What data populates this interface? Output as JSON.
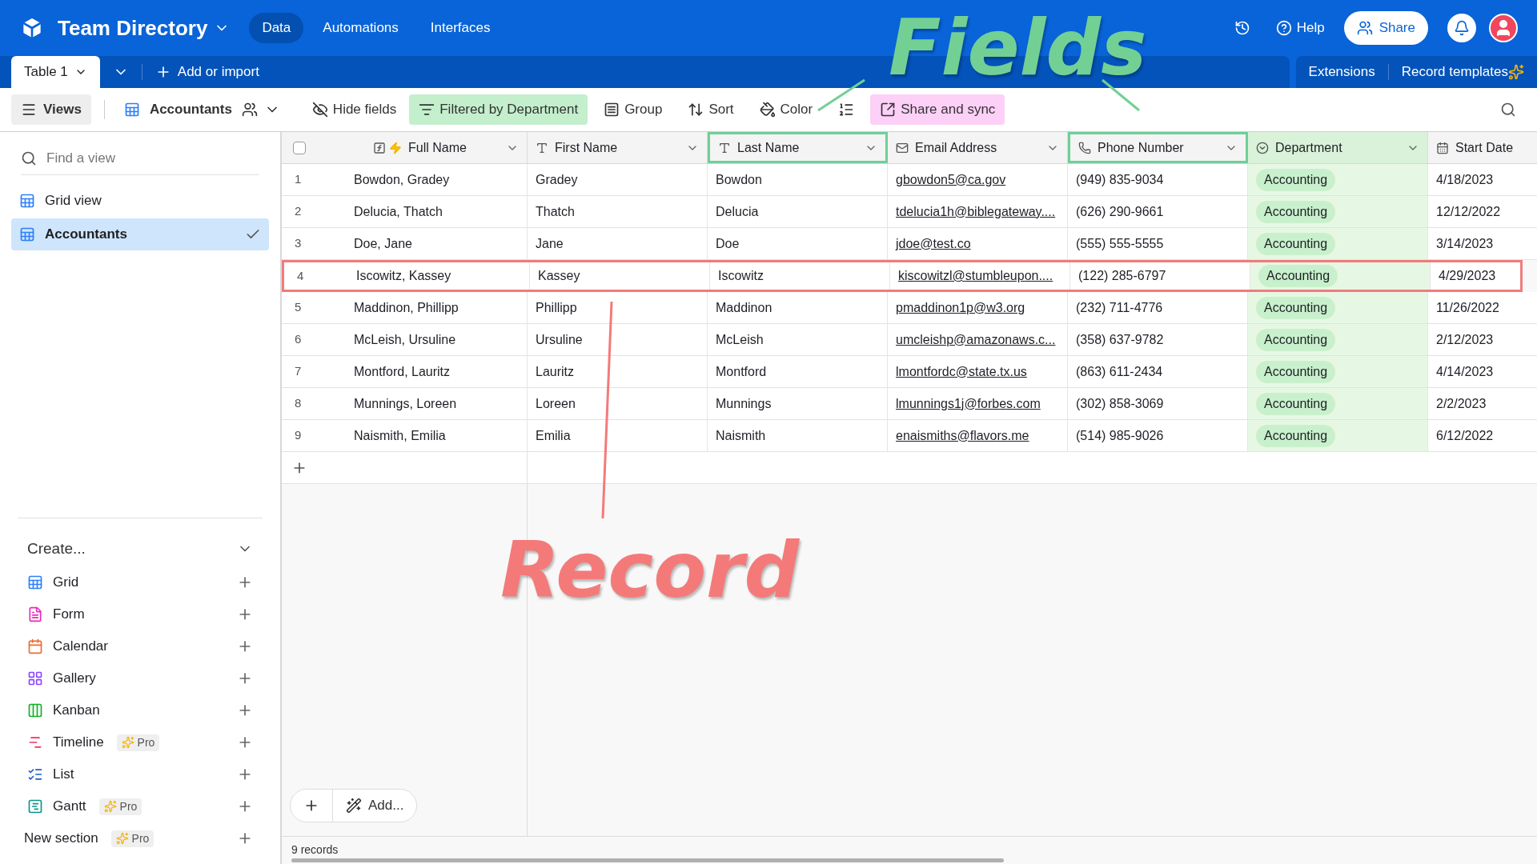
{
  "app": {
    "title": "Team Directory",
    "nav": [
      {
        "label": "Data",
        "selected": true
      },
      {
        "label": "Automations",
        "selected": false
      },
      {
        "label": "Interfaces",
        "selected": false
      }
    ],
    "help": "Help",
    "share": "Share"
  },
  "tabbar": {
    "table_tab": "Table 1",
    "add_or_import": "Add or import",
    "extensions": "Extensions",
    "record_templates": "Record templates"
  },
  "toolbar": {
    "views": "Views",
    "view_name": "Accountants",
    "hide_fields": "Hide fields",
    "filter": "Filtered by Department",
    "group": "Group",
    "sort": "Sort",
    "color_button": "Color",
    "share_sync": "Share and sync"
  },
  "sidebar": {
    "search_placeholder": "Find a view",
    "views": [
      {
        "label": "Grid view",
        "selected": false
      },
      {
        "label": "Accountants",
        "selected": true
      }
    ],
    "create": {
      "title": "Create...",
      "items": [
        {
          "label": "Grid",
          "kind": "grid"
        },
        {
          "label": "Form",
          "kind": "form"
        },
        {
          "label": "Calendar",
          "kind": "calendar"
        },
        {
          "label": "Gallery",
          "kind": "gallery"
        },
        {
          "label": "Kanban",
          "kind": "kanban"
        },
        {
          "label": "Timeline",
          "kind": "timeline",
          "badge": "Pro"
        },
        {
          "label": "List",
          "kind": "list"
        },
        {
          "label": "Gantt",
          "kind": "gantt",
          "badge": "Pro"
        },
        {
          "label": "New section",
          "kind": "section",
          "badge": "Pro"
        }
      ]
    }
  },
  "table": {
    "select_all_checked": false,
    "columns": [
      {
        "label": "Full Name",
        "kind": "formula",
        "outlined": false,
        "filtered": false
      },
      {
        "label": "First Name",
        "kind": "text",
        "outlined": false,
        "filtered": false
      },
      {
        "label": "Last Name",
        "kind": "text",
        "outlined": true,
        "filtered": false
      },
      {
        "label": "Email Address",
        "kind": "email",
        "outlined": false,
        "filtered": false
      },
      {
        "label": "Phone Number",
        "kind": "phone",
        "outlined": true,
        "filtered": false
      },
      {
        "label": "Department",
        "kind": "select",
        "outlined": false,
        "filtered": true
      },
      {
        "label": "Start Date",
        "kind": "date",
        "outlined": false,
        "filtered": false
      }
    ],
    "rows": [
      {
        "number": "1",
        "outlined": false,
        "cells": [
          "Bowdon, Gradey",
          "Gradey",
          "Bowdon",
          "gbowdon5@ca.gov",
          "(949) 835-9034",
          "Accounting",
          "4/18/2023"
        ]
      },
      {
        "number": "2",
        "outlined": false,
        "cells": [
          "Delucia, Thatch",
          "Thatch",
          "Delucia",
          "tdelucia1h@biblegateway....",
          "(626) 290-9661",
          "Accounting",
          "12/12/2022"
        ]
      },
      {
        "number": "3",
        "outlined": false,
        "cells": [
          "Doe, Jane",
          "Jane",
          "Doe",
          "jdoe@test.co",
          "(555) 555-5555",
          "Accounting",
          "3/14/2023"
        ]
      },
      {
        "number": "4",
        "outlined": true,
        "cells": [
          "Iscowitz, Kassey",
          "Kassey",
          "Iscowitz",
          "kiscowitzl@stumbleupon....",
          "(122) 285-6797",
          "Accounting",
          "4/29/2023"
        ]
      },
      {
        "number": "5",
        "outlined": false,
        "cells": [
          "Maddinon, Phillipp",
          "Phillipp",
          "Maddinon",
          "pmaddinon1p@w3.org",
          "(232) 711-4776",
          "Accounting",
          "11/26/2022"
        ]
      },
      {
        "number": "6",
        "outlined": false,
        "cells": [
          "McLeish, Ursuline",
          "Ursuline",
          "McLeish",
          "umcleishp@amazonaws.c...",
          "(358) 637-9782",
          "Accounting",
          "2/12/2023"
        ]
      },
      {
        "number": "7",
        "outlined": false,
        "cells": [
          "Montford, Lauritz",
          "Lauritz",
          "Montford",
          "lmontfordc@state.tx.us",
          "(863) 611-2434",
          "Accounting",
          "4/14/2023"
        ]
      },
      {
        "number": "8",
        "outlined": false,
        "cells": [
          "Munnings, Loreen",
          "Loreen",
          "Munnings",
          "lmunnings1j@forbes.com",
          "(302) 858-3069",
          "Accounting",
          "2/2/2023"
        ]
      },
      {
        "number": "9",
        "outlined": false,
        "cells": [
          "Naismith, Emilia",
          "Emilia",
          "Naismith",
          "enaismiths@flavors.me",
          "(514) 985-9026",
          "Accounting",
          "6/12/2022"
        ]
      }
    ]
  },
  "footer": {
    "add": "Add...",
    "record_count": "9 records"
  },
  "annotations": [
    {
      "text": "Fields",
      "kind": "fields"
    },
    {
      "text": "Record",
      "kind": "record"
    }
  ]
}
